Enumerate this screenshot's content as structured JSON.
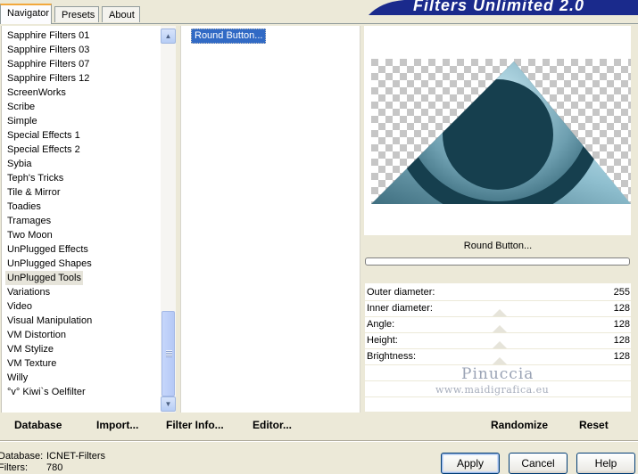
{
  "tabs": [
    "Navigator",
    "Presets",
    "About"
  ],
  "banner": "Filters Unlimited 2.0",
  "categories": [
    "Sapphire Filters 01",
    "Sapphire Filters 03",
    "Sapphire Filters 07",
    "Sapphire Filters 12",
    "ScreenWorks",
    "Scribe",
    "Simple",
    "Special Effects 1",
    "Special Effects 2",
    "Sybia",
    "Teph's Tricks",
    "Tile & Mirror",
    "Toadies",
    "Tramages",
    "Two Moon",
    "UnPlugged Effects",
    "UnPlugged Shapes",
    "UnPlugged Tools",
    "Variations",
    "Video",
    "Visual Manipulation",
    "VM Distortion",
    "VM Stylize",
    "VM Texture",
    "Willy",
    "°v° Kiwi`s Oelfilter"
  ],
  "selected_category": "UnPlugged Tools",
  "filters": [
    "Round Button..."
  ],
  "filter_title": "Round Button...",
  "sliders": [
    {
      "label": "Outer diameter:",
      "value": "255"
    },
    {
      "label": "Inner diameter:",
      "value": "128"
    },
    {
      "label": "Angle:",
      "value": "128"
    },
    {
      "label": "Height:",
      "value": "128"
    },
    {
      "label": "Brightness:",
      "value": "128"
    }
  ],
  "watermark": {
    "line1": "Pinuccia",
    "line2": "www.maidigrafica.eu"
  },
  "toolbar": {
    "database": "Database",
    "import": "Import...",
    "filter_info": "Filter Info...",
    "editor": "Editor...",
    "randomize": "Randomize",
    "reset": "Reset"
  },
  "status": {
    "database_label": "Database:",
    "database_value": "ICNET-Filters",
    "filters_label": "Filters:",
    "filters_value": "780"
  },
  "dialog": {
    "apply": "Apply",
    "cancel": "Cancel",
    "help": "Help"
  },
  "colors": {
    "accent": "#316ac5",
    "banner": "#1a2a8c",
    "preview_dark": "#153c4a",
    "preview_light": "#d8f4ff"
  }
}
